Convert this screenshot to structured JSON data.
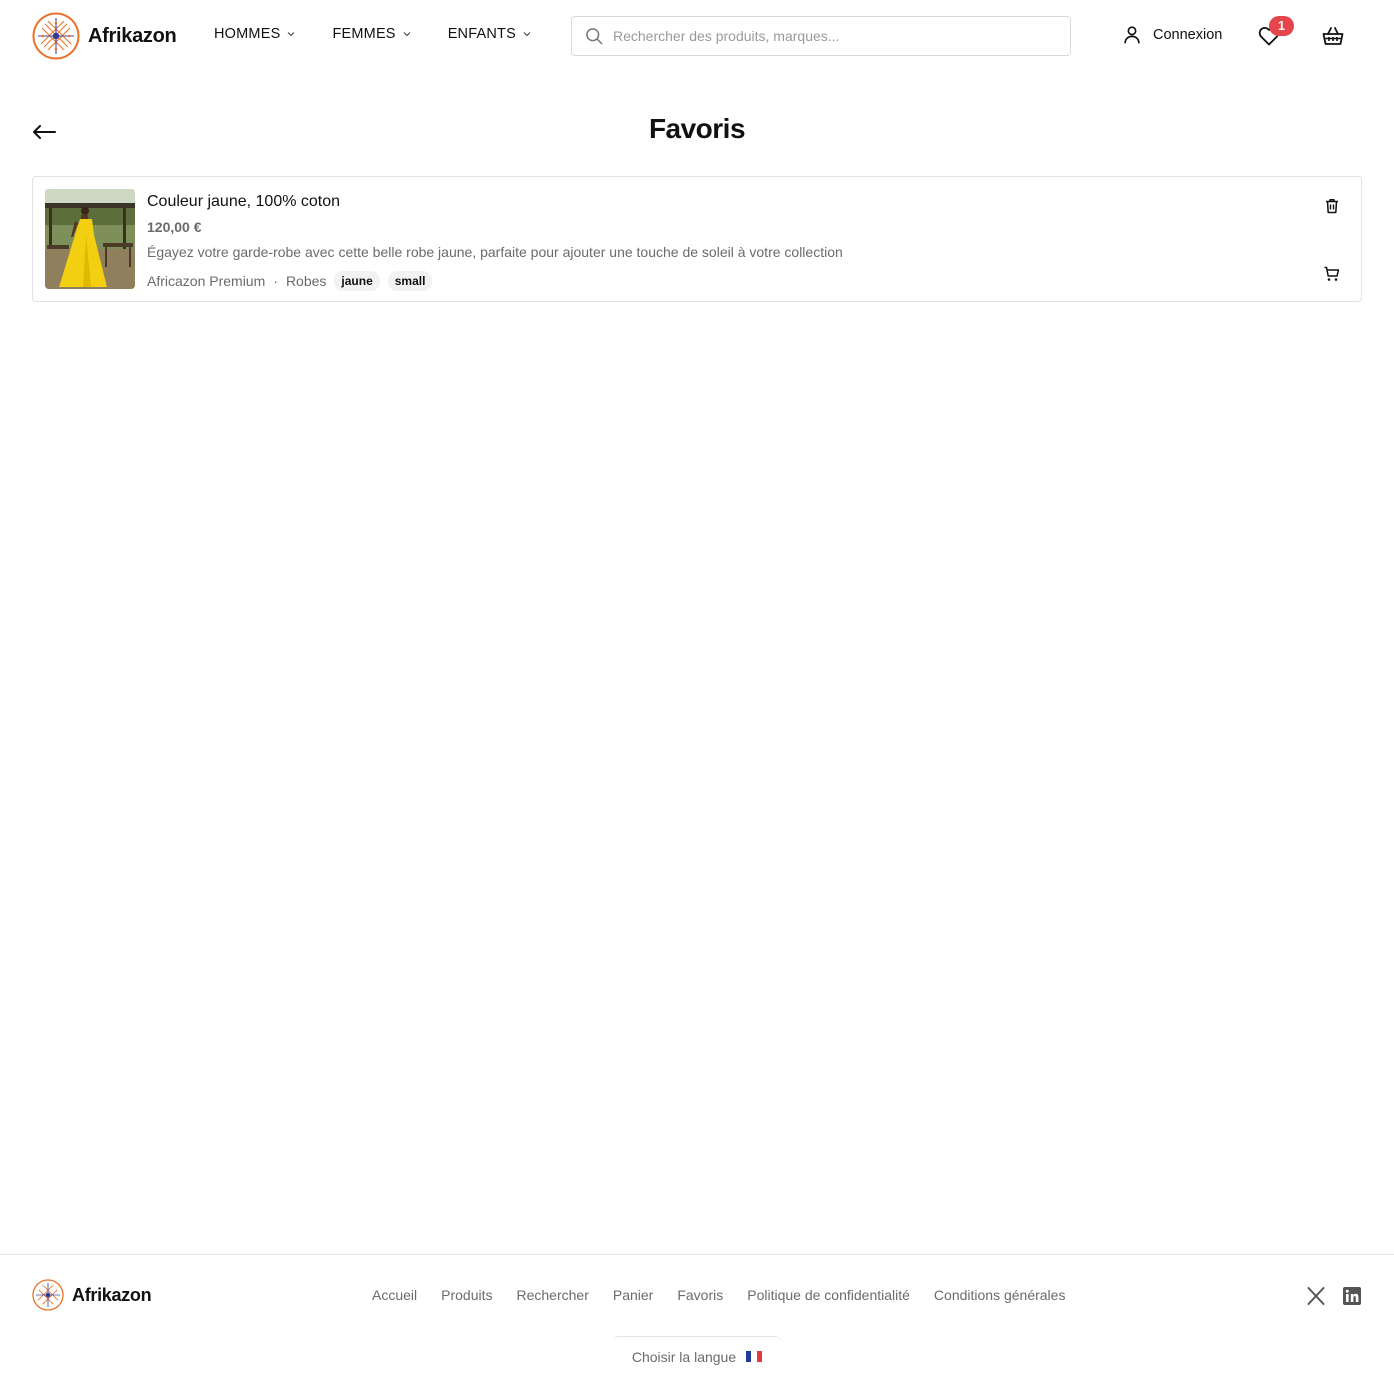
{
  "header": {
    "brand": "Afrikazon",
    "nav": [
      {
        "label": "HOMMES"
      },
      {
        "label": "FEMMES"
      },
      {
        "label": "ENFANTS"
      }
    ],
    "search": {
      "placeholder": "Rechercher des produits, marques...",
      "value": ""
    },
    "login_label": "Connexion",
    "favorites_count": "1"
  },
  "page": {
    "title": "Favoris"
  },
  "favorites": [
    {
      "name": "Couleur jaune, 100% coton",
      "price": "120,00 €",
      "description": "Égayez votre garde-robe avec cette belle robe jaune, parfaite pour ajouter une touche de soleil à votre collection",
      "brand": "Africazon Premium",
      "separator": "·",
      "category": "Robes",
      "tags": [
        "jaune",
        "small"
      ]
    }
  ],
  "footer": {
    "brand": "Afrikazon",
    "links": [
      "Accueil",
      "Produits",
      "Rechercher",
      "Panier",
      "Favoris",
      "Politique de confidentialité",
      "Conditions générales"
    ],
    "language_label": "Choisir la langue"
  },
  "colors": {
    "accent": "#e8742c",
    "badge": "#e6464b",
    "muted_text": "#6b6b6b"
  },
  "icons": [
    "search-icon",
    "user-icon",
    "heart-icon",
    "basket-icon",
    "back-arrow-icon",
    "trash-icon",
    "add-to-cart-icon",
    "x-logo-icon",
    "linkedin-icon",
    "flag-fr-icon"
  ]
}
